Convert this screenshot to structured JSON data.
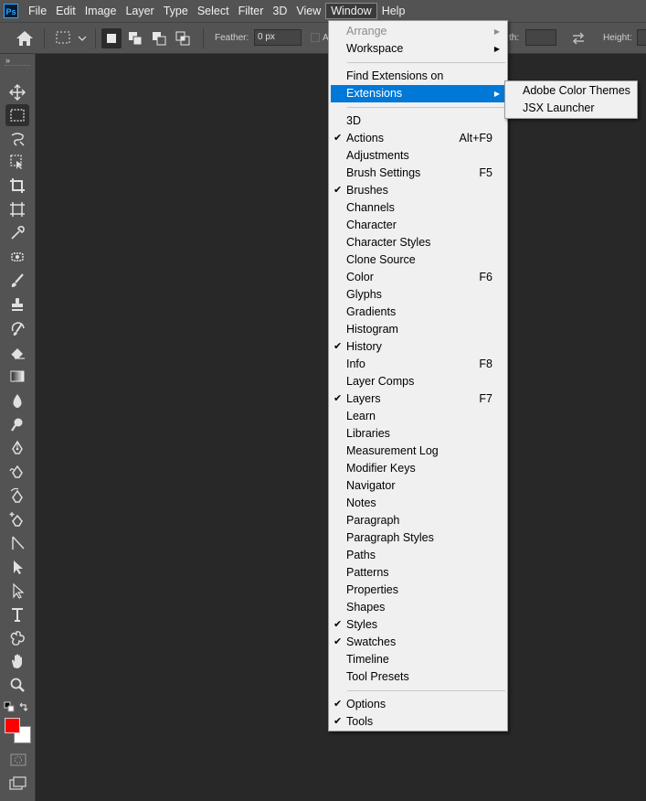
{
  "app": {
    "logo_text": "Ps"
  },
  "menubar": {
    "items": [
      "File",
      "Edit",
      "Image",
      "Layer",
      "Type",
      "Select",
      "Filter",
      "3D",
      "View",
      "Window",
      "Help"
    ],
    "active": "Window"
  },
  "options_bar": {
    "feather_label": "Feather:",
    "feather_value": "0 px",
    "antialias_label": "A",
    "width_label": "th:",
    "height_label": "Height:"
  },
  "toolbar": {
    "collapse_label": "»",
    "tools": [
      "move",
      "rectangular-marquee",
      "lasso",
      "object-selection",
      "crop",
      "frame",
      "eyedropper",
      "spot-healing-brush",
      "brush",
      "clone-stamp",
      "history-brush",
      "eraser",
      "gradient",
      "blur",
      "dodge",
      "pen",
      "freeform-pen",
      "curvature-pen",
      "add-anchor-point",
      "convert-point",
      "path-selection",
      "direct-selection",
      "type",
      "custom-shape",
      "hand",
      "zoom"
    ],
    "selected_tool": "rectangular-marquee",
    "foreground_color": "#ff0000",
    "background_color": "#ffffff"
  },
  "window_menu": {
    "items": [
      {
        "label": "Arrange",
        "disabled": true,
        "submenu": true
      },
      {
        "label": "Workspace",
        "submenu": true
      },
      {
        "sep": true
      },
      {
        "label": "Find Extensions on Exchange..."
      },
      {
        "label": "Extensions",
        "submenu": true,
        "highlighted": true
      },
      {
        "sep": true
      },
      {
        "label": "3D"
      },
      {
        "label": "Actions",
        "checked": true,
        "shortcut": "Alt+F9"
      },
      {
        "label": "Adjustments"
      },
      {
        "label": "Brush Settings",
        "shortcut": "F5"
      },
      {
        "label": "Brushes",
        "checked": true
      },
      {
        "label": "Channels"
      },
      {
        "label": "Character"
      },
      {
        "label": "Character Styles"
      },
      {
        "label": "Clone Source"
      },
      {
        "label": "Color",
        "shortcut": "F6"
      },
      {
        "label": "Glyphs"
      },
      {
        "label": "Gradients"
      },
      {
        "label": "Histogram"
      },
      {
        "label": "History",
        "checked": true
      },
      {
        "label": "Info",
        "shortcut": "F8"
      },
      {
        "label": "Layer Comps"
      },
      {
        "label": "Layers",
        "checked": true,
        "shortcut": "F7"
      },
      {
        "label": "Learn"
      },
      {
        "label": "Libraries"
      },
      {
        "label": "Measurement Log"
      },
      {
        "label": "Modifier Keys"
      },
      {
        "label": "Navigator"
      },
      {
        "label": "Notes"
      },
      {
        "label": "Paragraph"
      },
      {
        "label": "Paragraph Styles"
      },
      {
        "label": "Paths"
      },
      {
        "label": "Patterns"
      },
      {
        "label": "Properties"
      },
      {
        "label": "Shapes"
      },
      {
        "label": "Styles",
        "checked": true
      },
      {
        "label": "Swatches",
        "checked": true
      },
      {
        "label": "Timeline"
      },
      {
        "label": "Tool Presets"
      },
      {
        "sep": true
      },
      {
        "label": "Options",
        "checked": true
      },
      {
        "label": "Tools",
        "checked": true
      }
    ]
  },
  "extensions_submenu": {
    "items": [
      "Adobe Color Themes",
      "JSX Launcher"
    ]
  }
}
